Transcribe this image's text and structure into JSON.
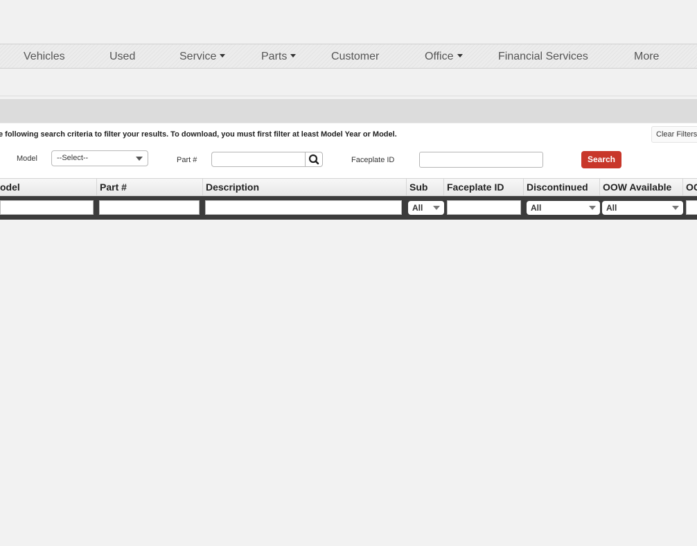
{
  "nav": {
    "items": [
      {
        "label": "Vehicles",
        "dropdown": false
      },
      {
        "label": "Used",
        "dropdown": false
      },
      {
        "label": "Service",
        "dropdown": true
      },
      {
        "label": "Parts",
        "dropdown": true
      },
      {
        "label": "Customer",
        "dropdown": false
      },
      {
        "label": "Office",
        "dropdown": true
      },
      {
        "label": "Financial Services",
        "dropdown": false
      },
      {
        "label": "More",
        "dropdown": false
      }
    ]
  },
  "filters": {
    "instructions": "e following search criteria to filter your results. To download, you must first filter at least Model Year or Model.",
    "clear_label": "Clear Filters",
    "model_label": "Model",
    "model_value": "--Select--",
    "part_label": "Part #",
    "faceplate_label": "Faceplate ID",
    "search_label": "Search"
  },
  "table": {
    "columns": [
      "odel",
      "Part #",
      "Description",
      "Sub",
      "Faceplate ID",
      "Discontinued",
      "OOW Available",
      "OC"
    ],
    "filter_selects": {
      "sub": "All",
      "discontinued": "All",
      "oow_available": "All"
    }
  }
}
